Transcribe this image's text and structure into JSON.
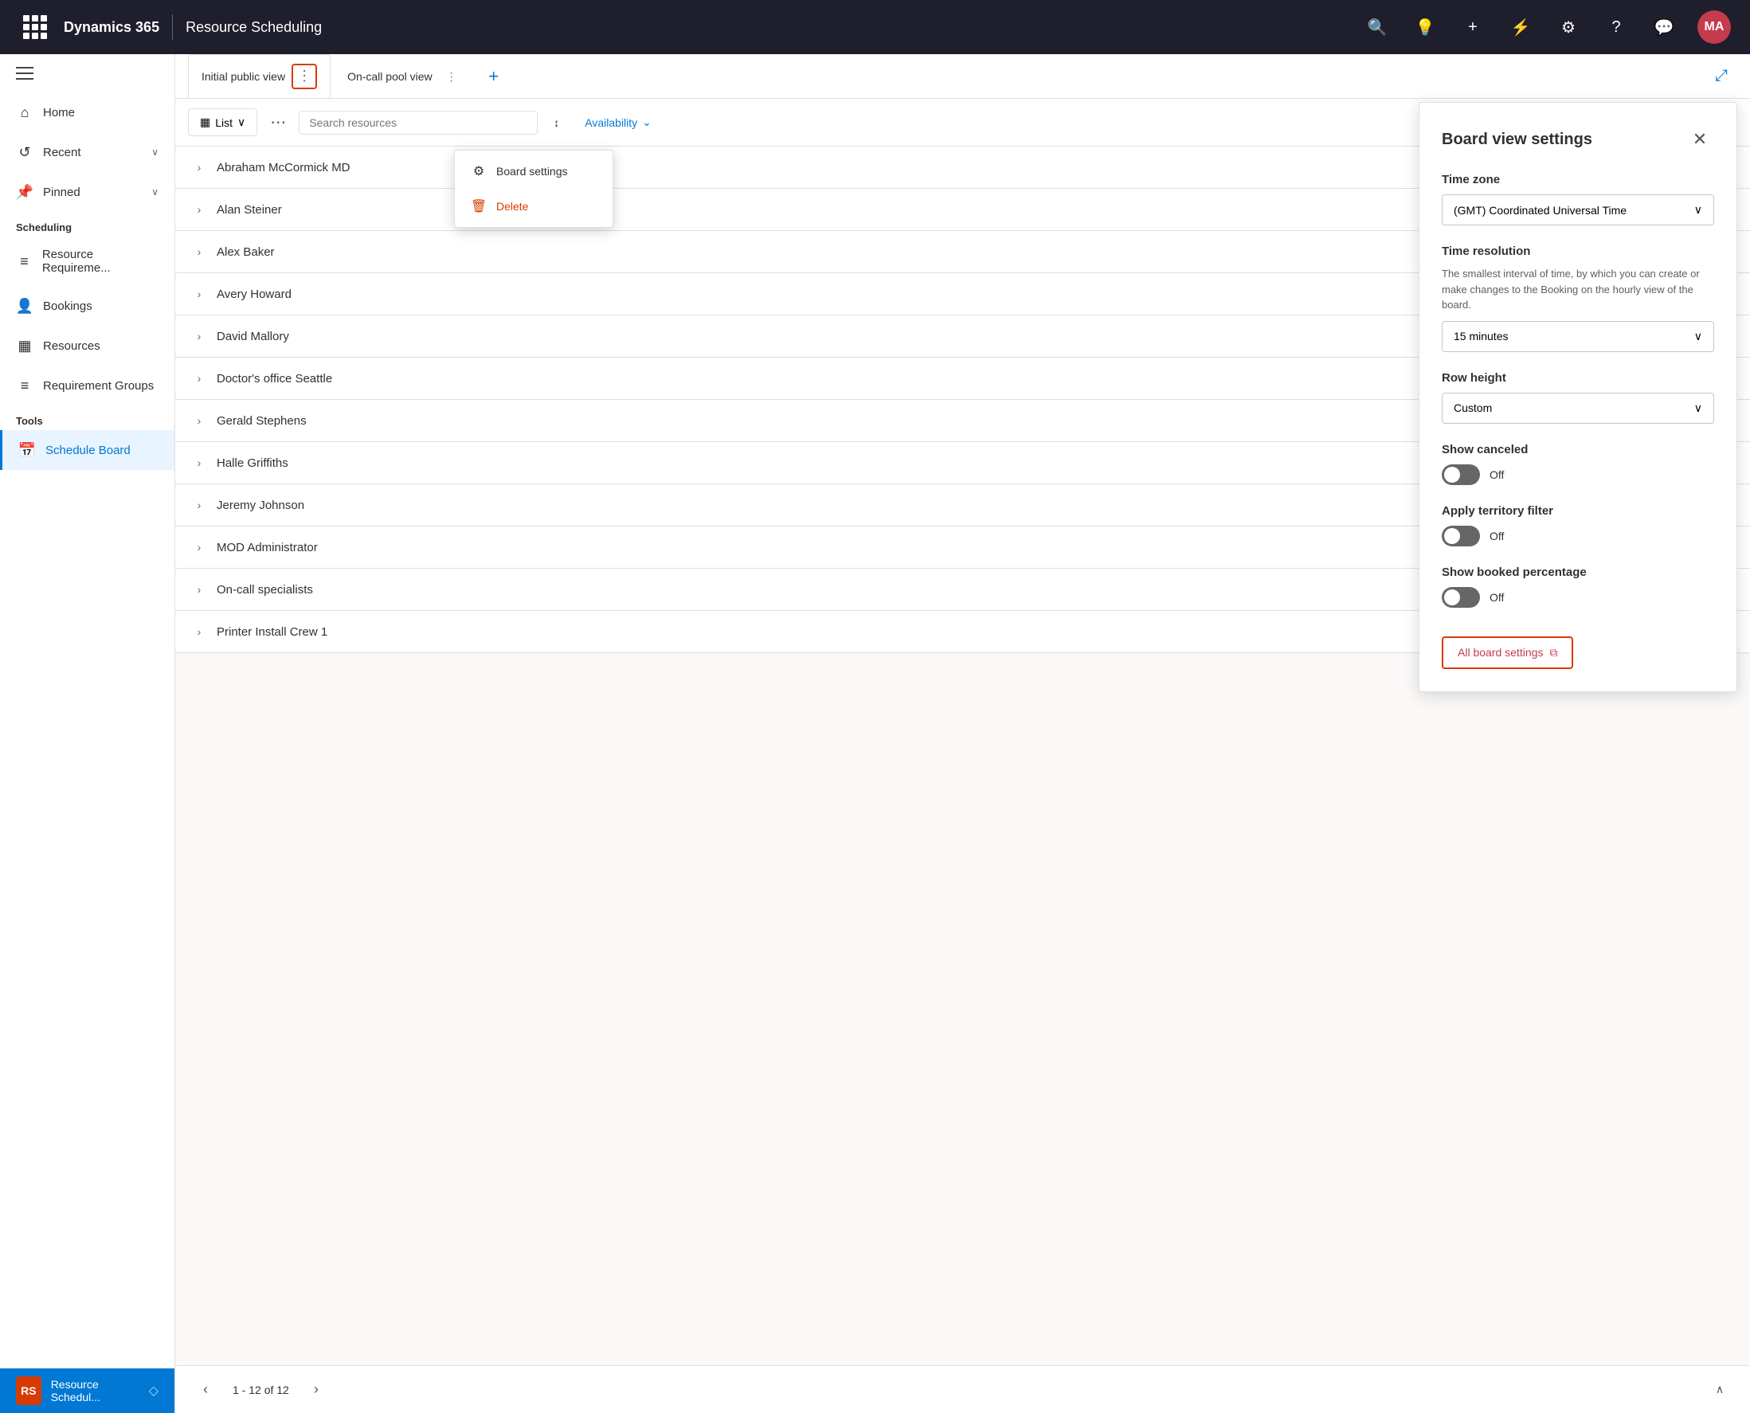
{
  "topbar": {
    "brand": "Dynamics 365",
    "module": "Resource Scheduling",
    "avatar_initials": "MA"
  },
  "sidebar": {
    "sections": [
      {
        "items": [
          {
            "id": "home",
            "label": "Home",
            "icon": "⌂"
          },
          {
            "id": "recent",
            "label": "Recent",
            "icon": "↺",
            "expand": true
          },
          {
            "id": "pinned",
            "label": "Pinned",
            "icon": "📌",
            "expand": true
          }
        ]
      },
      {
        "title": "Scheduling",
        "items": [
          {
            "id": "resource-requirements",
            "label": "Resource Requireme...",
            "icon": "≡"
          },
          {
            "id": "bookings",
            "label": "Bookings",
            "icon": "👤"
          },
          {
            "id": "resources",
            "label": "Resources",
            "icon": "▦"
          },
          {
            "id": "requirement-groups",
            "label": "Requirement Groups",
            "icon": "≡"
          }
        ]
      },
      {
        "title": "Tools",
        "items": [
          {
            "id": "schedule-board",
            "label": "Schedule Board",
            "icon": "📅",
            "active": true
          }
        ]
      }
    ]
  },
  "tabs": [
    {
      "id": "initial-public-view",
      "label": "Initial public view",
      "active": true,
      "has_more": true
    },
    {
      "id": "on-call-pool-view",
      "label": "On-call pool view",
      "has_more": true
    }
  ],
  "tab_add_label": "+",
  "board_toolbar": {
    "view_label": "List",
    "sources_placeholder": "Search resources",
    "sort_label": "↕",
    "availability_label": "Availability",
    "availability_chevron": "⌄"
  },
  "resources": [
    {
      "name": "Abraham McCormick MD"
    },
    {
      "name": "Alan Steiner"
    },
    {
      "name": "Alex Baker"
    },
    {
      "name": "Avery Howard"
    },
    {
      "name": "David Mallory"
    },
    {
      "name": "Doctor's office Seattle"
    },
    {
      "name": "Gerald Stephens"
    },
    {
      "name": "Halle Griffiths"
    },
    {
      "name": "Jeremy Johnson"
    },
    {
      "name": "MOD Administrator"
    },
    {
      "name": "On-call specialists"
    },
    {
      "name": "Printer Install Crew 1"
    }
  ],
  "pagination": {
    "info": "1 - 12 of 12",
    "prev": "‹",
    "next": "›",
    "collapse": "∧"
  },
  "dropdown_menu": {
    "items": [
      {
        "id": "board-settings",
        "label": "Board settings",
        "icon": "⚙"
      },
      {
        "id": "delete",
        "label": "Delete",
        "icon": "🗑",
        "color_red": true
      }
    ]
  },
  "settings_panel": {
    "title": "Board view settings",
    "close_icon": "✕",
    "sections": [
      {
        "id": "time-zone",
        "label": "Time zone",
        "type": "select",
        "value": "(GMT) Coordinated Universal Time"
      },
      {
        "id": "time-resolution",
        "label": "Time resolution",
        "description": "The smallest interval of time, by which you can create or make changes to the Booking on the hourly view of the board.",
        "type": "select",
        "value": "15 minutes"
      },
      {
        "id": "row-height",
        "label": "Row height",
        "type": "select",
        "value": "Custom"
      },
      {
        "id": "show-canceled",
        "label": "Show canceled",
        "type": "toggle",
        "enabled": false,
        "toggle_label": "Off"
      },
      {
        "id": "apply-territory-filter",
        "label": "Apply territory filter",
        "type": "toggle",
        "enabled": false,
        "toggle_label": "Off"
      },
      {
        "id": "show-booked-percentage",
        "label": "Show booked percentage",
        "type": "toggle",
        "enabled": false,
        "toggle_label": "Off"
      }
    ],
    "link_button_label": "All board settings",
    "link_button_icon": "⬡"
  },
  "bottom_bar": {
    "icon_text": "RS",
    "text": "Resource Schedul...",
    "diamond": "◇"
  }
}
